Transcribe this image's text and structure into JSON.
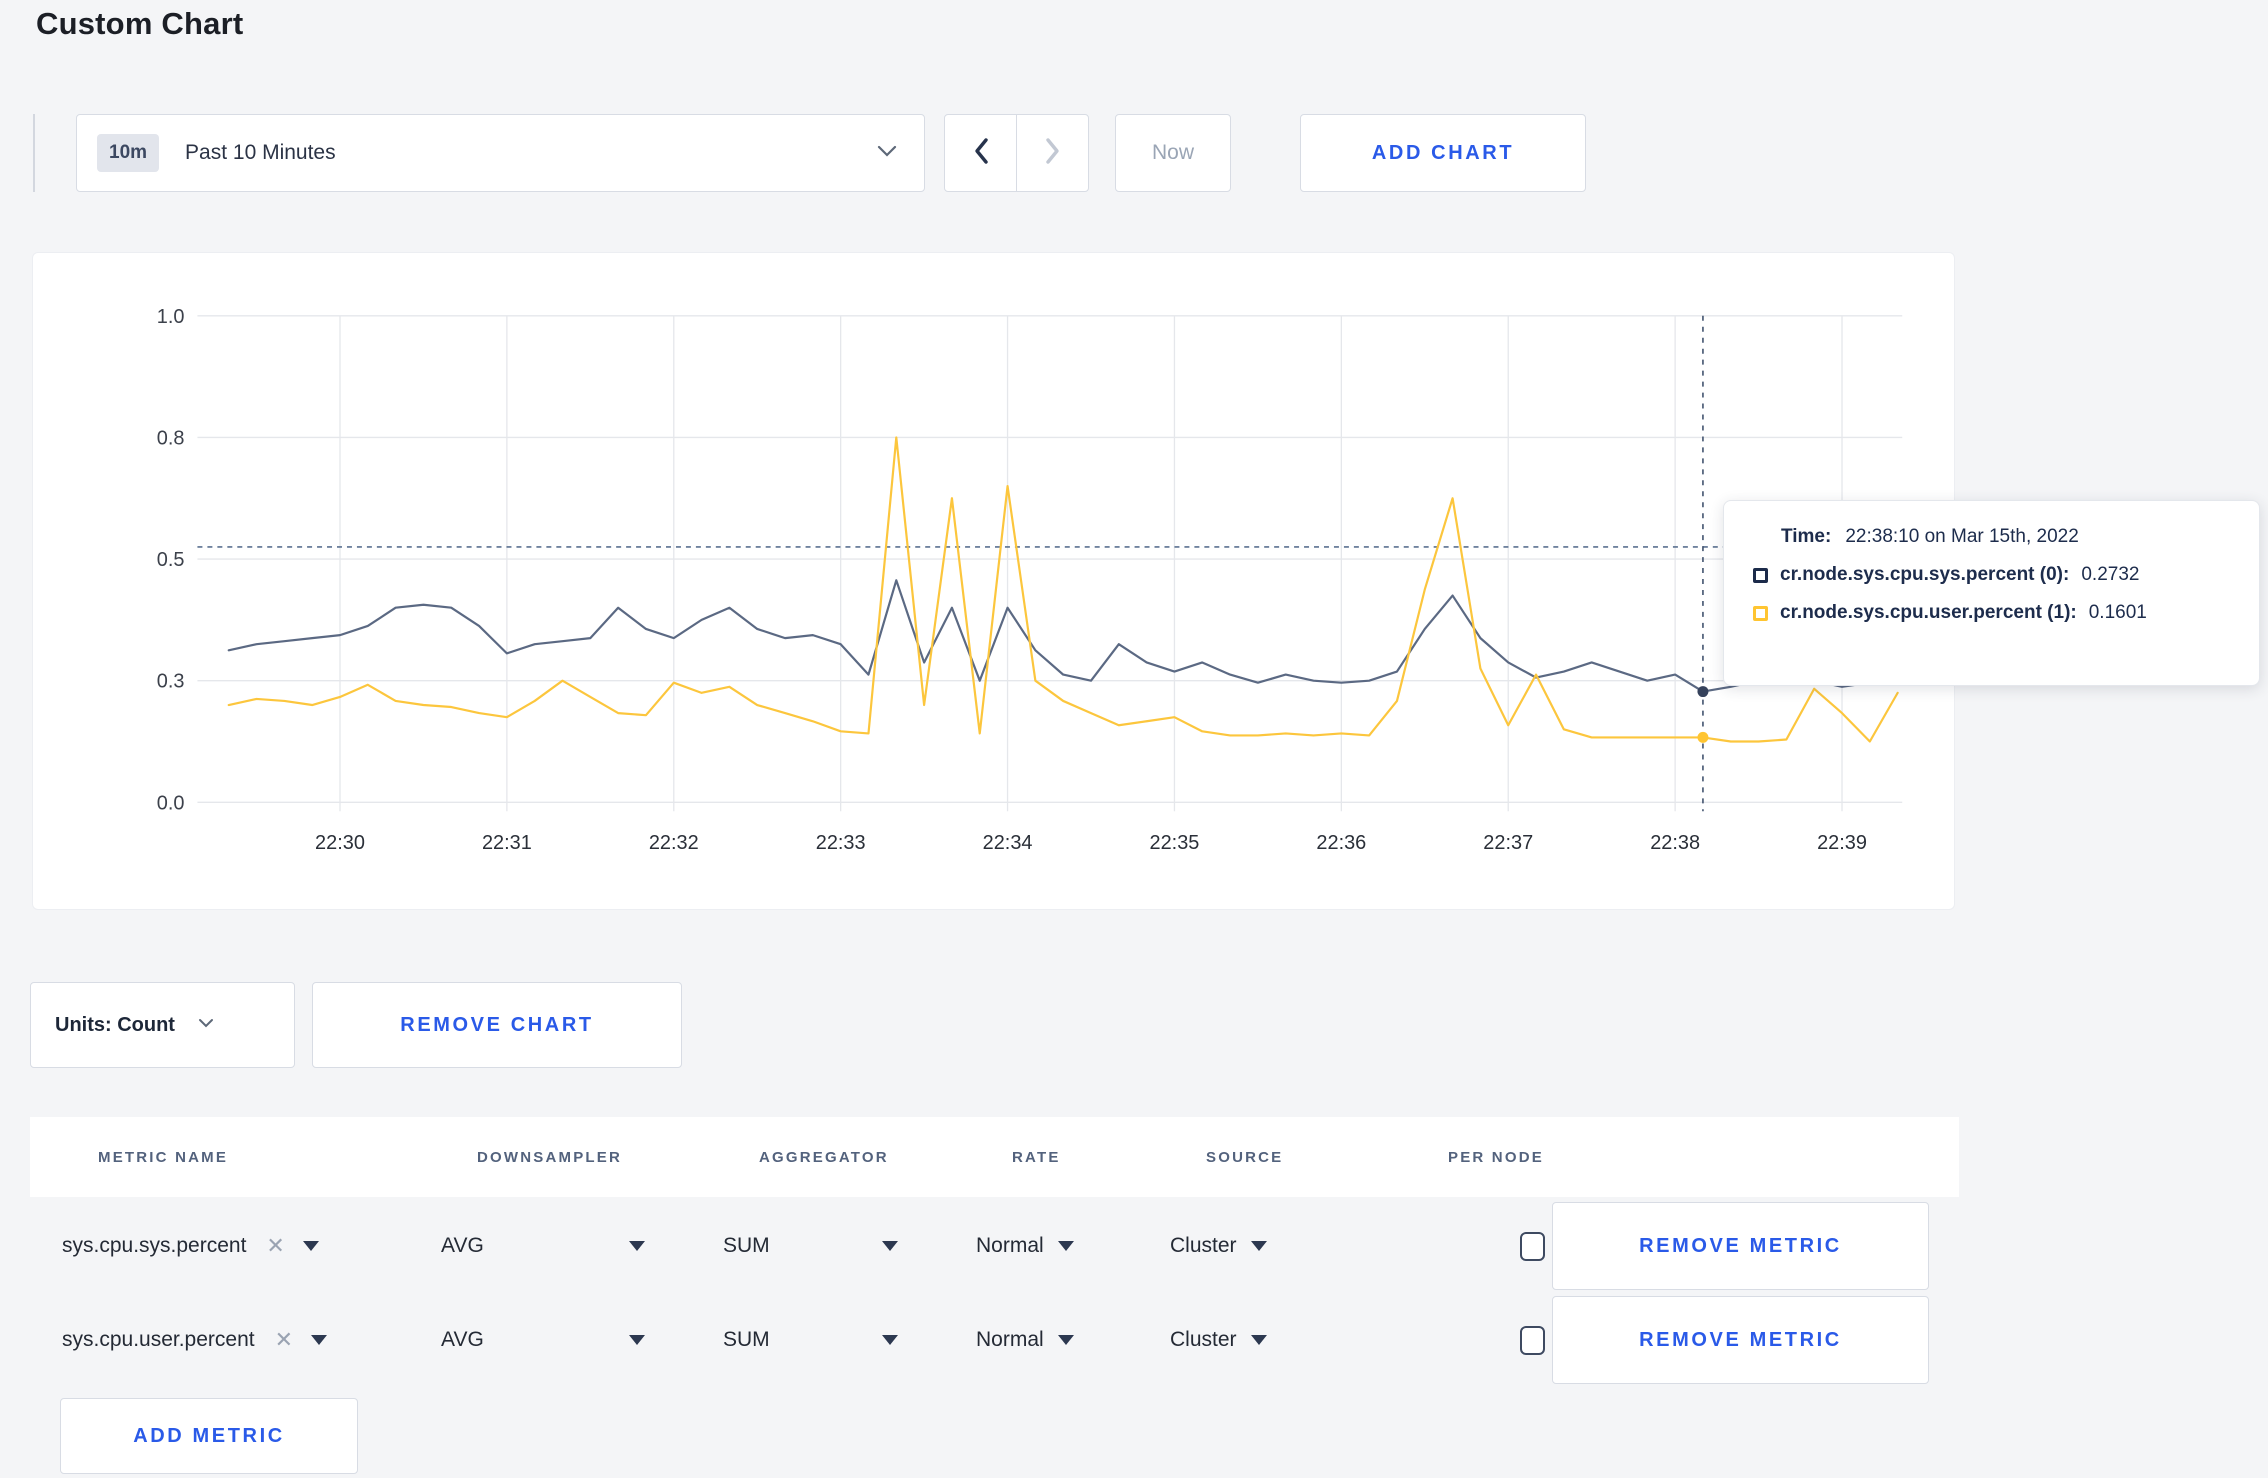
{
  "page": {
    "title": "Custom Chart",
    "background": "#f4f5f7",
    "accent_blue": "#2a5ae8"
  },
  "toolbar": {
    "time_window_badge": "10m",
    "time_window_label": "Past 10 Minutes",
    "prev_label": "previous time window",
    "next_label": "next time window",
    "now_label": "Now",
    "add_chart_label": "ADD CHART"
  },
  "chart": {
    "tooltip": {
      "time_label": "Time:",
      "time_value": "22:38:10 on Mar 15th, 2022",
      "rows": [
        {
          "name": "cr.node.sys.cpu.sys.percent (0):",
          "value": "0.2732",
          "color": "#1c2b4a"
        },
        {
          "name": "cr.node.sys.cpu.user.percent (1):",
          "value": "0.1601",
          "color": "#ffc531"
        }
      ]
    }
  },
  "chart_data": {
    "type": "line",
    "title": "",
    "xlabel": "",
    "ylabel": "",
    "ylim": [
      0,
      1
    ],
    "grid": true,
    "legend_position": "tooltip",
    "y_tick_labels_top_down": [
      "1.0",
      "0.8",
      "0.5",
      "0.3",
      "0.0"
    ],
    "x_tick_labels": [
      "22:30",
      "22:31",
      "22:32",
      "22:33",
      "22:34",
      "22:35",
      "22:36",
      "22:37",
      "22:38",
      "22:39"
    ],
    "threshold_value": 0.53,
    "crosshair_index": 53,
    "crosshair_time": "22:38:10",
    "x": [
      "22:29:20",
      "22:29:30",
      "22:29:40",
      "22:29:50",
      "22:30:00",
      "22:30:10",
      "22:30:20",
      "22:30:30",
      "22:30:40",
      "22:30:50",
      "22:31:00",
      "22:31:10",
      "22:31:20",
      "22:31:30",
      "22:31:40",
      "22:31:50",
      "22:32:00",
      "22:32:10",
      "22:32:20",
      "22:32:30",
      "22:32:40",
      "22:32:50",
      "22:33:00",
      "22:33:10",
      "22:33:20",
      "22:33:30",
      "22:33:40",
      "22:33:50",
      "22:34:00",
      "22:34:10",
      "22:34:20",
      "22:34:30",
      "22:34:40",
      "22:34:50",
      "22:35:00",
      "22:35:10",
      "22:35:20",
      "22:35:30",
      "22:35:40",
      "22:35:50",
      "22:36:00",
      "22:36:10",
      "22:36:20",
      "22:36:30",
      "22:36:40",
      "22:36:50",
      "22:37:00",
      "22:37:10",
      "22:37:20",
      "22:37:30",
      "22:37:40",
      "22:37:50",
      "22:38:00",
      "22:38:10",
      "22:38:20",
      "22:38:30",
      "22:38:40",
      "22:38:50",
      "22:39:00",
      "22:39:10",
      "22:39:20"
    ],
    "series": [
      {
        "name": "cr.node.sys.cpu.sys.percent",
        "color": "#5b6983",
        "dot_color": "#36425c",
        "values": [
          0.35,
          0.36,
          0.365,
          0.37,
          0.375,
          0.39,
          0.42,
          0.425,
          0.42,
          0.39,
          0.345,
          0.36,
          0.365,
          0.37,
          0.42,
          0.385,
          0.37,
          0.4,
          0.42,
          0.385,
          0.37,
          0.375,
          0.36,
          0.31,
          0.465,
          0.33,
          0.42,
          0.3,
          0.42,
          0.35,
          0.31,
          0.3,
          0.36,
          0.33,
          0.315,
          0.33,
          0.31,
          0.295,
          0.31,
          0.3,
          0.295,
          0.3,
          0.315,
          0.385,
          0.44,
          0.37,
          0.33,
          0.305,
          0.315,
          0.33,
          0.315,
          0.3,
          0.31,
          0.2732,
          0.285,
          0.3,
          0.315,
          0.3,
          0.285,
          0.295,
          0.305
        ]
      },
      {
        "name": "cr.node.sys.cpu.user.percent",
        "color": "#fcc63d",
        "dot_color": "#ffc531",
        "values": [
          0.24,
          0.255,
          0.25,
          0.24,
          0.26,
          0.29,
          0.25,
          0.24,
          0.235,
          0.22,
          0.21,
          0.25,
          0.3,
          0.26,
          0.22,
          0.215,
          0.295,
          0.27,
          0.285,
          0.24,
          0.22,
          0.2,
          0.175,
          0.17,
          0.8,
          0.24,
          0.65,
          0.17,
          0.68,
          0.3,
          0.25,
          0.22,
          0.19,
          0.2,
          0.21,
          0.175,
          0.165,
          0.165,
          0.17,
          0.165,
          0.17,
          0.165,
          0.25,
          0.45,
          0.65,
          0.32,
          0.19,
          0.31,
          0.18,
          0.16,
          0.16,
          0.16,
          0.16,
          0.1601,
          0.15,
          0.15,
          0.155,
          0.28,
          0.22,
          0.15,
          0.27
        ]
      }
    ]
  },
  "units_bar": {
    "units_label": "Units: Count",
    "remove_chart_label": "REMOVE CHART"
  },
  "metrics_table": {
    "headers": [
      "METRIC NAME",
      "DOWNSAMPLER",
      "AGGREGATOR",
      "RATE",
      "SOURCE",
      "PER NODE"
    ],
    "rows": [
      {
        "metric_name": "sys.cpu.sys.percent",
        "downsampler": "AVG",
        "aggregator": "SUM",
        "rate": "Normal",
        "source": "Cluster",
        "per_node_checked": false,
        "remove_label": "REMOVE METRIC"
      },
      {
        "metric_name": "sys.cpu.user.percent",
        "downsampler": "AVG",
        "aggregator": "SUM",
        "rate": "Normal",
        "source": "Cluster",
        "per_node_checked": false,
        "remove_label": "REMOVE METRIC"
      }
    ],
    "add_metric_label": "ADD METRIC"
  }
}
